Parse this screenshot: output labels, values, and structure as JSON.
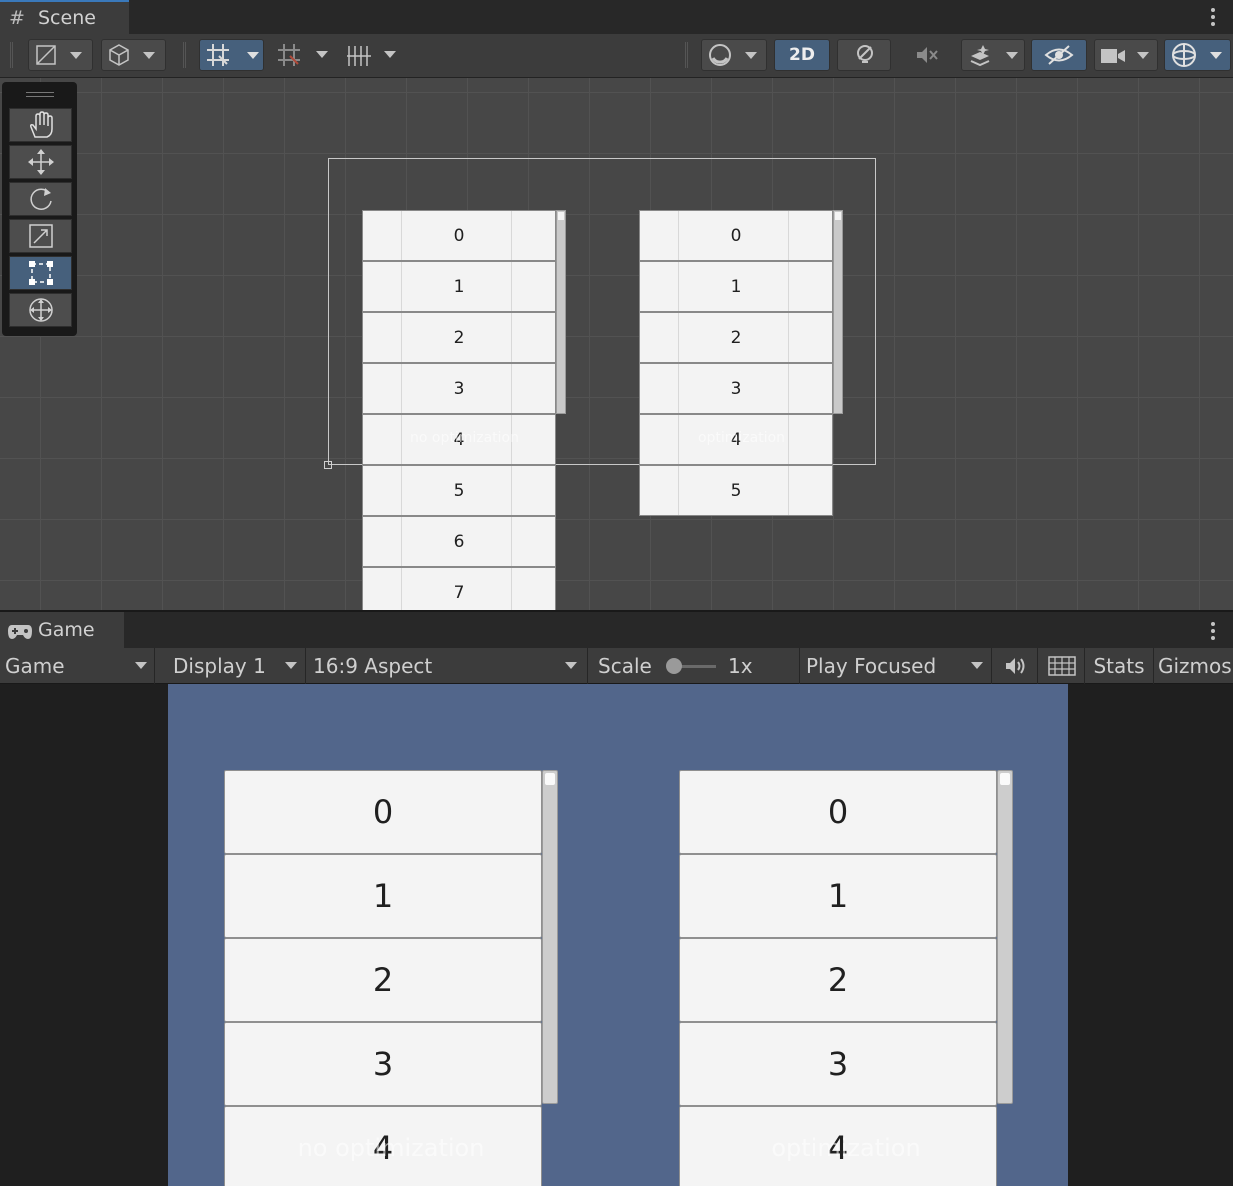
{
  "scene": {
    "tab_label": "Scene",
    "toolbar": {
      "mode_2d_label": "2D"
    },
    "left_list": {
      "items": [
        "0",
        "1",
        "2",
        "3",
        "4",
        "5",
        "6",
        "7"
      ],
      "overlay_label": "no optimization"
    },
    "right_list": {
      "items": [
        "0",
        "1",
        "2",
        "3",
        "4",
        "5"
      ],
      "overlay_label": "optimization"
    },
    "tools": [
      "hand-tool",
      "move-tool",
      "rotate-tool",
      "scale-tool",
      "rect-tool",
      "transform-tool"
    ],
    "active_tool": "rect-tool"
  },
  "game": {
    "tab_label": "Game",
    "toolbar": {
      "view_select": "Game",
      "display_select": "Display 1",
      "aspect_select": "16:9 Aspect",
      "scale_label": "Scale",
      "scale_value": "1x",
      "play_mode_select": "Play Focused",
      "stats_label": "Stats",
      "gizmos_label": "Gizmos"
    },
    "background_color": "#52668b",
    "left_list": {
      "items": [
        "0",
        "1",
        "2",
        "3",
        "4"
      ],
      "overlay_label": "no optimization"
    },
    "right_list": {
      "items": [
        "0",
        "1",
        "2",
        "3",
        "4"
      ],
      "overlay_label": "optimization"
    }
  },
  "colors": {
    "accent": "#46607c",
    "tab_highlight": "#3a79bb"
  }
}
